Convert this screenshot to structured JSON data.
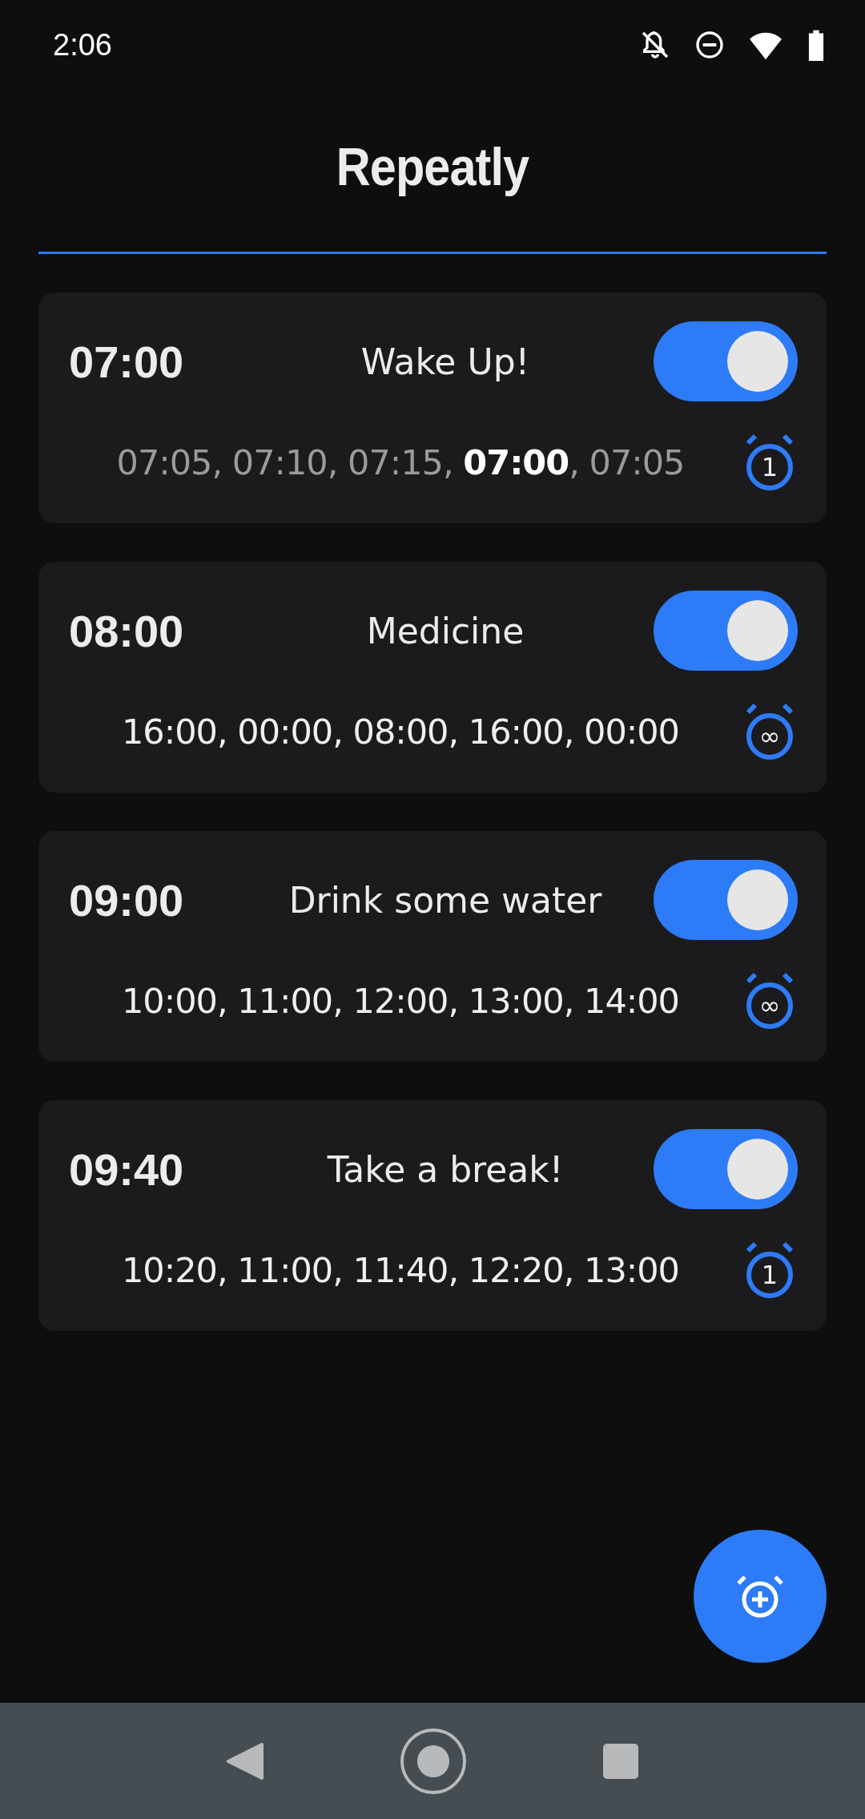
{
  "status_bar": {
    "time": "2:06"
  },
  "title": "Repeatly",
  "alarms": [
    {
      "time": "07:00",
      "label": "Wake Up!",
      "on": true,
      "badge": "1",
      "schedule": [
        {
          "text": "07:05, ",
          "kind": "dim"
        },
        {
          "text": "07:10, ",
          "kind": "dim"
        },
        {
          "text": "07:15, ",
          "kind": "dim"
        },
        {
          "text": "07:00",
          "kind": "current"
        },
        {
          "text": ", 07:05",
          "kind": "dim"
        }
      ]
    },
    {
      "time": "08:00",
      "label": "Medicine",
      "on": true,
      "badge": "∞",
      "schedule": [
        {
          "text": "16:00, 00:00, 08:00, 16:00, 00:00",
          "kind": "normal"
        }
      ]
    },
    {
      "time": "09:00",
      "label": "Drink some water",
      "on": true,
      "badge": "∞",
      "schedule": [
        {
          "text": "10:00, 11:00, 12:00, 13:00, 14:00",
          "kind": "normal"
        }
      ]
    },
    {
      "time": "09:40",
      "label": "Take a break!",
      "on": true,
      "badge": "1",
      "schedule": [
        {
          "text": "10:20, 11:00, 11:40, 12:20, 13:00",
          "kind": "normal"
        }
      ]
    }
  ]
}
